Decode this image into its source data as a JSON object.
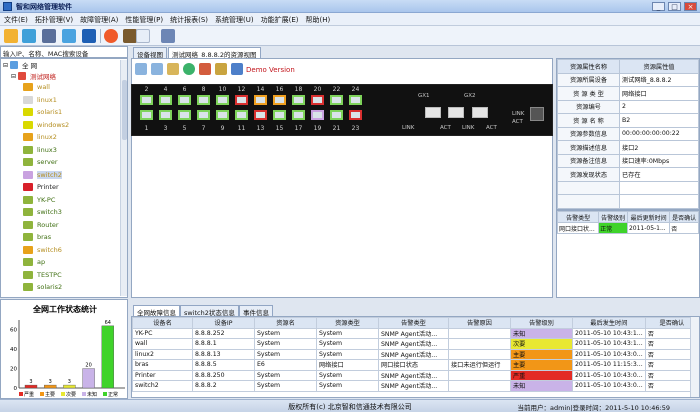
{
  "app": {
    "title": "智和网络管理软件"
  },
  "menu": [
    "文件(E)",
    "拓扑管理(V)",
    "故障管理(A)",
    "性能管理(P)",
    "统计报表(S)",
    "系统管理(U)",
    "功能扩展(E)",
    "帮助(H)"
  ],
  "search": {
    "placeholder": "输入IP、名称、MAC搜索设备"
  },
  "tree": {
    "root": "全 网",
    "group": "测试网络",
    "items": [
      {
        "label": "wall",
        "color": "#e7a21b"
      },
      {
        "label": "linux1",
        "color": "#d8d8d8"
      },
      {
        "label": "solaris1",
        "color": "#d9d900"
      },
      {
        "label": "windows2",
        "color": "#d9d900"
      },
      {
        "label": "linux2",
        "color": "#e7a21b"
      },
      {
        "label": "linux3",
        "color": "#8fb43c"
      },
      {
        "label": "server",
        "color": "#8fb43c"
      },
      {
        "label": "switch2",
        "color": "#c9a2e0"
      },
      {
        "label": "Printer",
        "color": "#d8202a"
      },
      {
        "label": "YK-PC",
        "color": "#8fb43c"
      },
      {
        "label": "switch3",
        "color": "#8fb43c"
      },
      {
        "label": "Router",
        "color": "#8fb43c"
      },
      {
        "label": "bras",
        "color": "#8fb43c"
      },
      {
        "label": "switch6",
        "color": "#e7a21b"
      },
      {
        "label": "ap",
        "color": "#8fb43c"
      },
      {
        "label": "TESTPC",
        "color": "#8fb43c"
      },
      {
        "label": "solaris2",
        "color": "#8fb43c"
      }
    ]
  },
  "stat": {
    "title": "全网工作状态统计",
    "chart_data": {
      "type": "bar",
      "categories": [
        "严重",
        "主要",
        "次要",
        "未知",
        "正常"
      ],
      "values": [
        3,
        3,
        3,
        20,
        64
      ],
      "colors": [
        "#e32b25",
        "#f29617",
        "#e8e833",
        "#c9b3e8",
        "#3fd32a"
      ],
      "ylim": [
        0,
        70
      ],
      "yticks": [
        0,
        20,
        40,
        60
      ]
    }
  },
  "tabs_top": [
    "设备视图",
    "测试网络_8.8.8.2的资源视图"
  ],
  "view": {
    "demo": "Demo Version"
  },
  "switch": {
    "top_nums": [
      "2",
      "4",
      "6",
      "8",
      "10",
      "12",
      "14",
      "16",
      "18",
      "20",
      "22",
      "24"
    ],
    "bottom_nums": [
      "1",
      "3",
      "5",
      "7",
      "9",
      "11",
      "13",
      "15",
      "17",
      "19",
      "21",
      "23"
    ],
    "top_colors": [
      "#7ed35a",
      "#7ed35a",
      "#7ed35a",
      "#7ed35a",
      "#7ed35a",
      "#d93030",
      "#f0a020",
      "#f0a020",
      "#7ed35a",
      "#d93030",
      "#7ed35a",
      "#7ed35a"
    ],
    "bottom_colors": [
      "#7ed35a",
      "#7ed35a",
      "#7ed35a",
      "#7ed35a",
      "#7ed35a",
      "#7ed35a",
      "#d93030",
      "#7ed35a",
      "#7ed35a",
      "#c9a2e0",
      "#7ed35a",
      "#d93030"
    ],
    "gx1": "GX1",
    "gx2": "GX2",
    "link": "LINK",
    "act": "ACT"
  },
  "props": {
    "head": [
      "资源属性名称",
      "资源属性值"
    ],
    "rows": [
      [
        "资源所属设备",
        "测试网络_8.8.8.2"
      ],
      [
        "资 源 类 型",
        "网络接口"
      ],
      [
        "资源编号",
        "2"
      ],
      [
        "资 源 名 称",
        "B2"
      ],
      [
        "资源参数信息",
        "00:00:00:00:00:22"
      ],
      [
        "资源描述信息",
        "接口2"
      ],
      [
        "资源备注信息",
        "接口速率:0Mbps"
      ],
      [
        "资源发现状态",
        "已存在"
      ]
    ]
  },
  "alarm_mini": {
    "head": [
      "告警类型",
      "告警级别",
      "最后更新时间",
      "是否确认"
    ],
    "rows": [
      [
        "网口接口状...",
        "正常",
        "2011-05-1...",
        "否"
      ]
    ]
  },
  "tabs_bottom": [
    "全网故障信息",
    "switch2状态信息",
    "事件信息"
  ],
  "faults": {
    "head": [
      "设备名",
      "设备IP",
      "资源名",
      "资源类型",
      "告警类型",
      "告警原因",
      "告警级别",
      "最后发生时间",
      "是否确认"
    ],
    "rows": [
      [
        "YK-PC",
        "8.8.8.252",
        "System",
        "System",
        "SNMP Agent活动...",
        "",
        "未知",
        "2011-05-10 10:43:1...",
        "否"
      ],
      [
        "wall",
        "8.8.8.1",
        "System",
        "System",
        "SNMP Agent活动...",
        "",
        "次要",
        "2011-05-10 10:43:1...",
        "否"
      ],
      [
        "linux2",
        "8.8.8.13",
        "System",
        "System",
        "SNMP Agent活动...",
        "",
        "主要",
        "2011-05-10 10:43:0...",
        "否"
      ],
      [
        "bras",
        "8.8.8.5",
        "E6",
        "网络接口",
        "网口接口状态",
        "接口未运行但运行",
        "主要",
        "2011-05-10 11:15:3...",
        "否"
      ],
      [
        "Printer",
        "8.8.8.250",
        "System",
        "System",
        "SNMP Agent活动...",
        "",
        "严重",
        "2011-05-10 10:43:0...",
        "否"
      ],
      [
        "switch2",
        "8.8.8.2",
        "System",
        "System",
        "SNMP Agent活动...",
        "",
        "未知",
        "2011-05-10 10:43:0...",
        "否"
      ]
    ],
    "level_colors": {
      "未知": "#c9b3e8",
      "次要": "#e8e833",
      "主要": "#f29617",
      "严重": "#e32b25",
      "正常": "#3fd32a"
    }
  },
  "status": {
    "copyright": "版权所有(c) 北京智和信通技术有限公司",
    "login": "当前用户：admin|登录时间：2011-5-10 10:46:59"
  }
}
